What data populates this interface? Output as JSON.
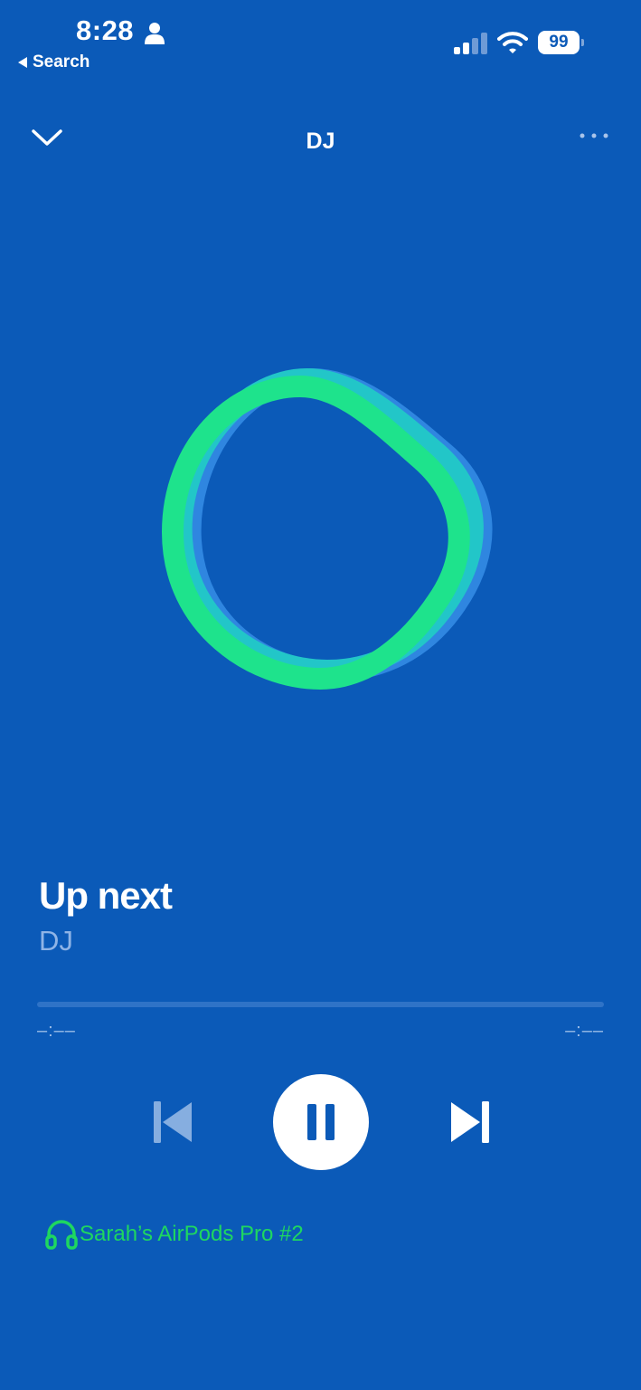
{
  "status_bar": {
    "time": "8:28",
    "back_label": "Search",
    "battery": "99",
    "icons": [
      "person-icon",
      "signal-icon",
      "wifi-icon",
      "battery-icon"
    ]
  },
  "header": {
    "title": "DJ",
    "left_icon": "chevron-down-icon",
    "right_icon": "more-icon"
  },
  "track": {
    "title": "Up next",
    "artist": "DJ"
  },
  "playback": {
    "elapsed": "–:––",
    "remaining": "–:––",
    "progress": 0,
    "controls": [
      "skip-previous-icon",
      "pause-icon",
      "skip-next-icon"
    ]
  },
  "device": {
    "name": "Sarah’s AirPods Pro #2",
    "icon": "headphones-icon"
  },
  "colors": {
    "background": "#0b5ab8",
    "accent_green": "#1ed760",
    "artist_text": "#8fb4e6"
  }
}
